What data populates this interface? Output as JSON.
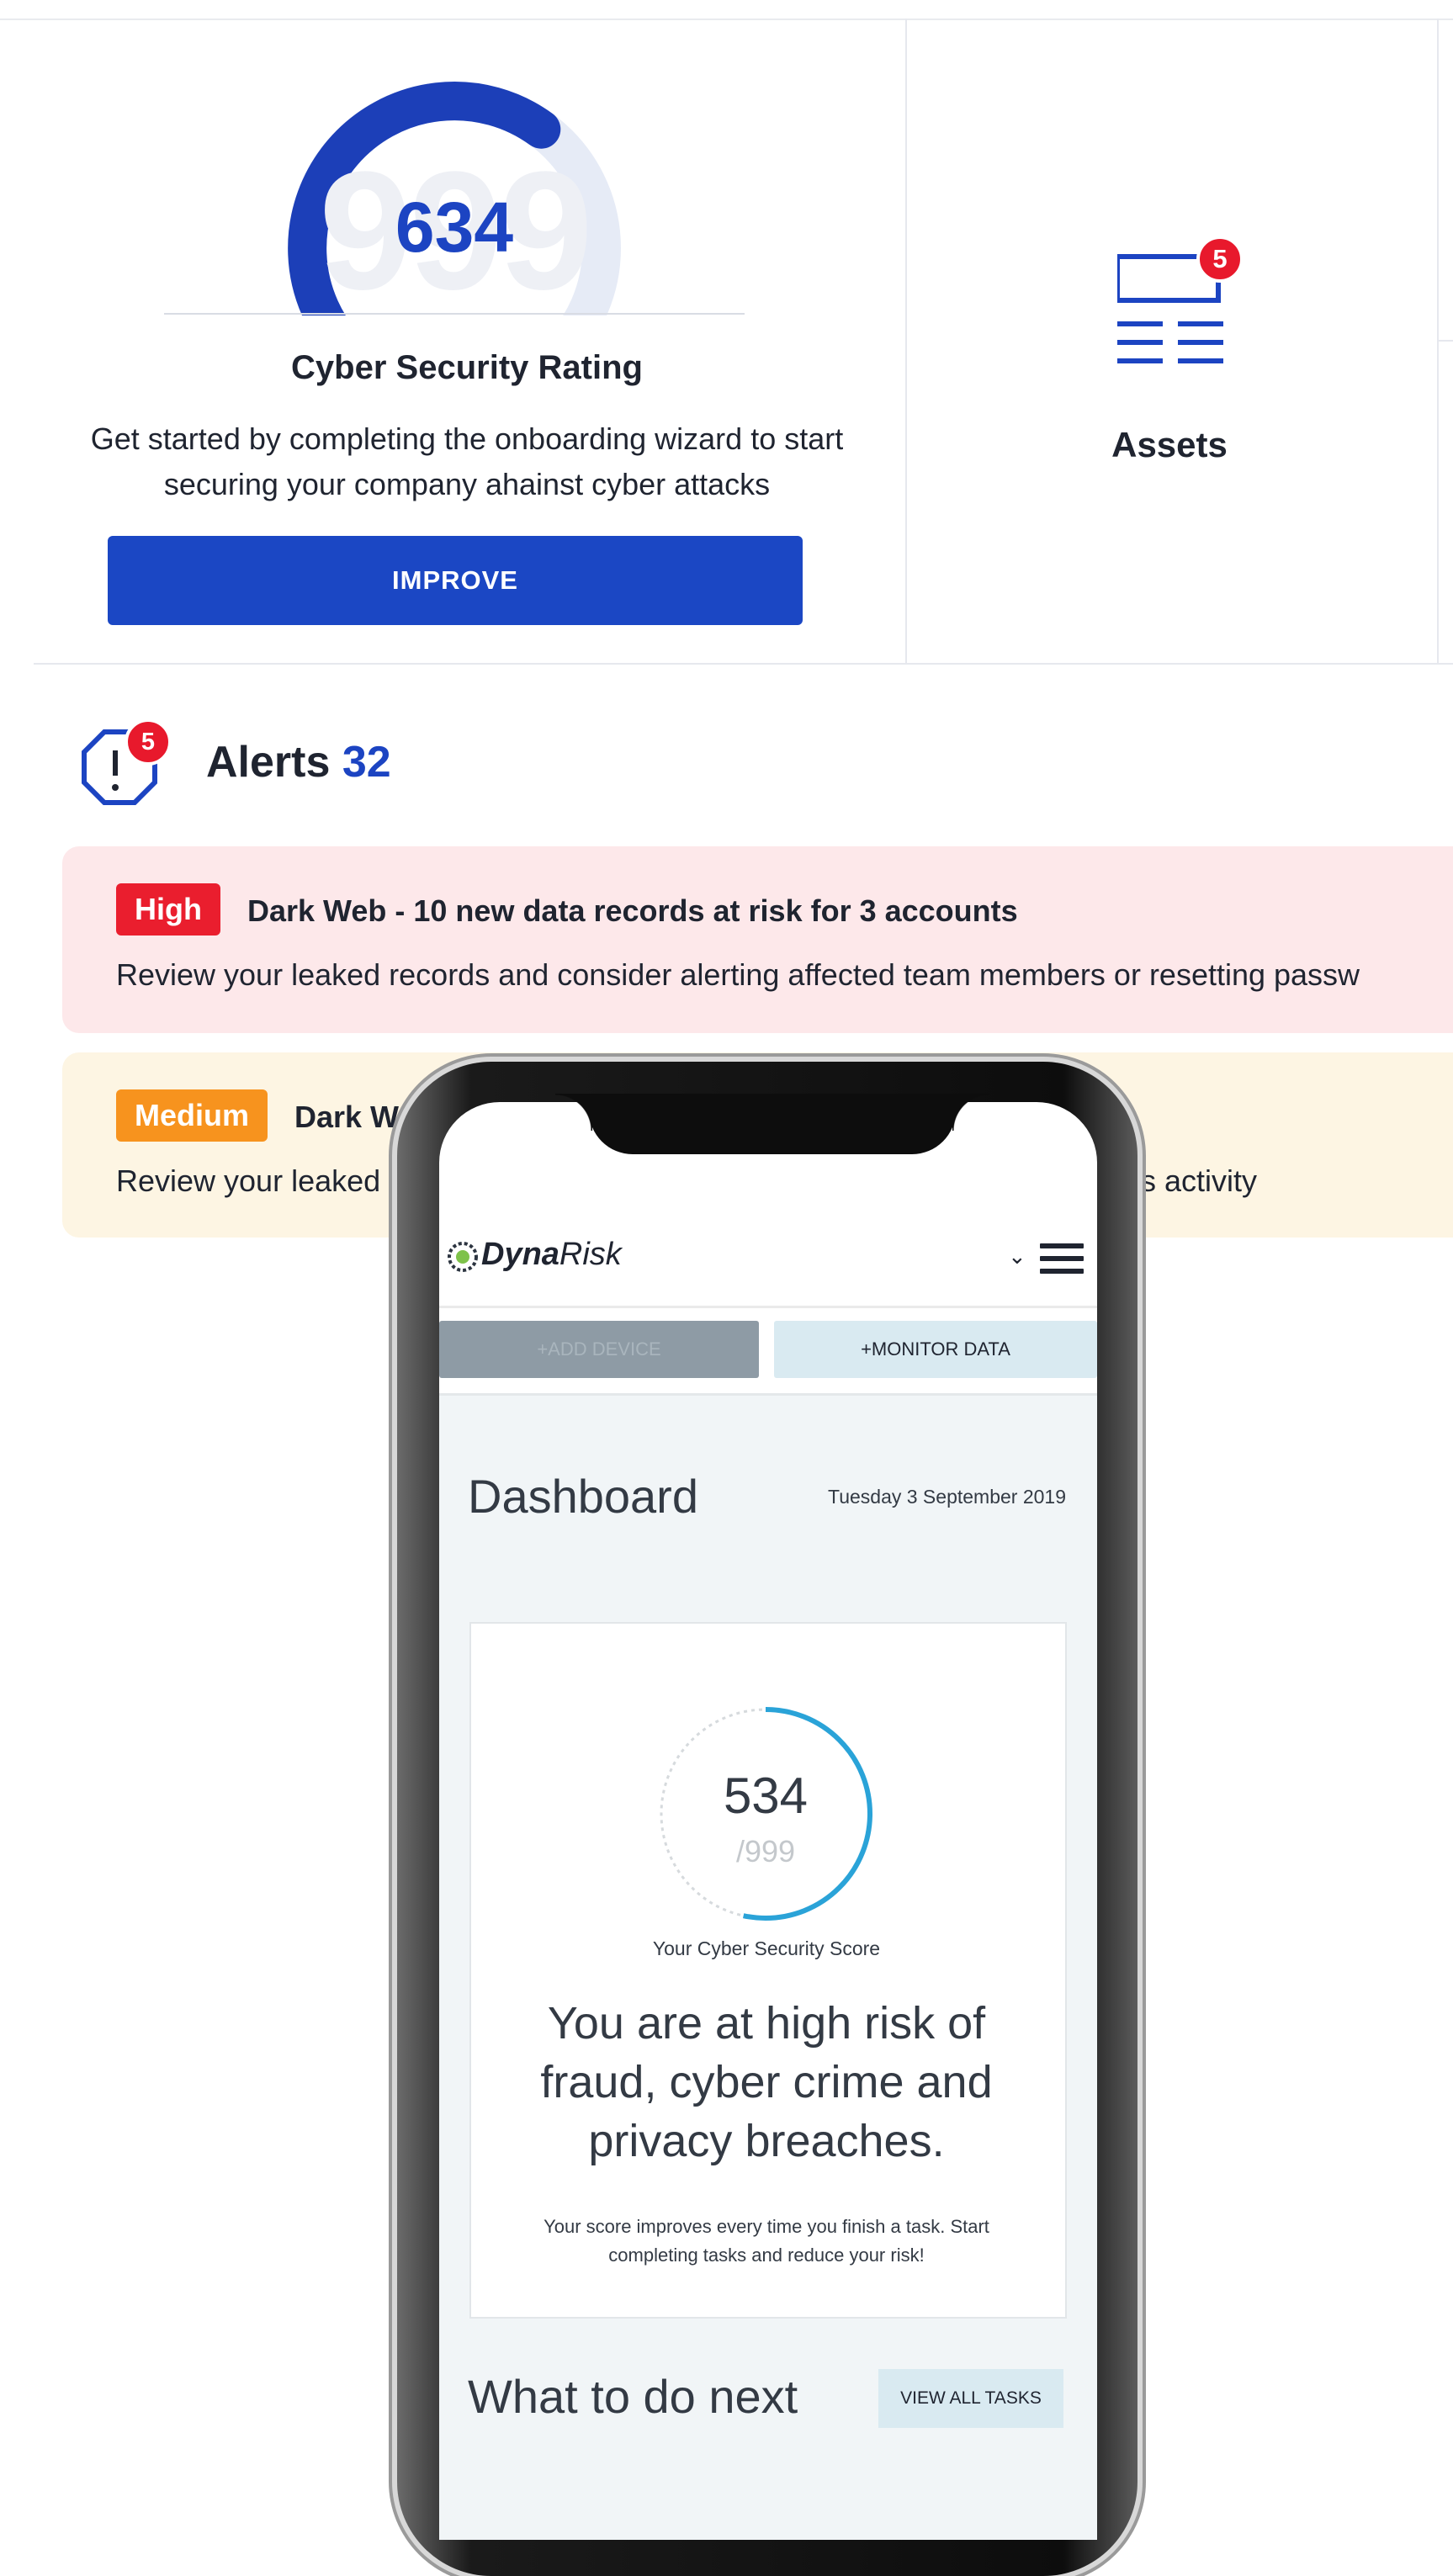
{
  "rating_card": {
    "score": "634",
    "max_watermark": "999",
    "title": "Cyber Security Rating",
    "description": "Get started by completing the onboarding wizard to start securing your company ahainst cyber attacks",
    "improve_label": "IMPROVE",
    "gauge_fraction": 0.634,
    "gauge_color": "#1c3fb8"
  },
  "assets_card": {
    "label": "Assets",
    "badge": "5",
    "icon": "assets-list-icon"
  },
  "alerts": {
    "title": "Alerts",
    "count": "32",
    "badge": "5",
    "icon": "alert-octagon-icon",
    "items": [
      {
        "severity": "High",
        "title": "Dark Web - 10 new data records at risk for 3 accounts",
        "description": "Review your leaked records and consider alerting affected team members or resetting passw",
        "color": "#ea1e2e"
      },
      {
        "severity": "Medium",
        "title": "Dark W",
        "description": "Review your leaked",
        "description_tail": "us activity",
        "color": "#f7931e"
      }
    ]
  },
  "mobile": {
    "logo_bold": "Dyna",
    "logo_light": "Risk",
    "add_device": "+ADD DEVICE",
    "monitor_data": "+MONITOR DATA",
    "dashboard_title": "Dashboard",
    "date": "Tuesday 3 September 2019",
    "score": "534",
    "score_max": "/999",
    "score_fraction": 0.534,
    "score_label": "Your Cyber Security Score",
    "risk_message": "You are at high risk of fraud, cyber crime and privacy breaches.",
    "tip": "Your score improves every time you finish a task. Start completing tasks and reduce your risk!",
    "next_title": "What to do next",
    "view_all_tasks": "VIEW ALL TASKS",
    "accent": "#2aa3d8"
  }
}
